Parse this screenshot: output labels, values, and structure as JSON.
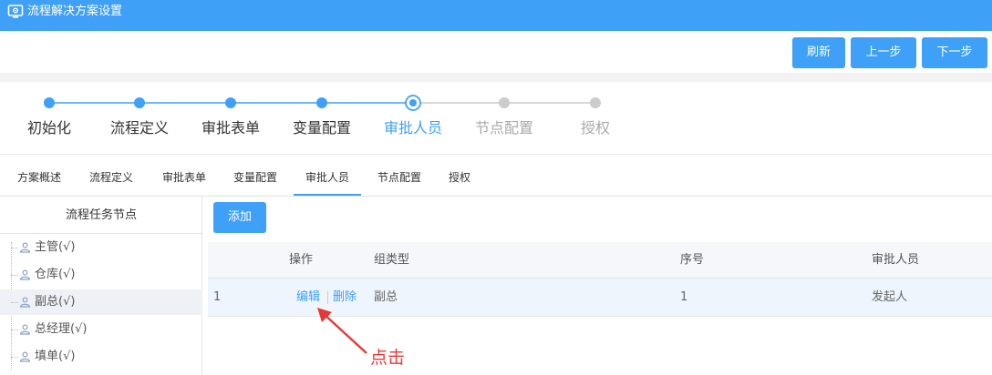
{
  "window": {
    "title": "流程解决方案设置",
    "icon": "settings-monitor-icon"
  },
  "toolbar": {
    "refresh": "刷新",
    "prev": "上一步",
    "next": "下一步"
  },
  "steps": [
    {
      "label": "初始化",
      "state": "done"
    },
    {
      "label": "流程定义",
      "state": "done"
    },
    {
      "label": "审批表单",
      "state": "done"
    },
    {
      "label": "变量配置",
      "state": "done"
    },
    {
      "label": "审批人员",
      "state": "active"
    },
    {
      "label": "节点配置",
      "state": "todo"
    },
    {
      "label": "授权",
      "state": "todo"
    }
  ],
  "tabs": [
    {
      "label": "方案概述"
    },
    {
      "label": "流程定义"
    },
    {
      "label": "审批表单"
    },
    {
      "label": "变量配置"
    },
    {
      "label": "审批人员",
      "active": true
    },
    {
      "label": "节点配置"
    },
    {
      "label": "授权"
    }
  ],
  "tree": {
    "header": "流程任务节点",
    "items": [
      {
        "label": "主管(√)"
      },
      {
        "label": "仓库(√)"
      },
      {
        "label": "副总(√)",
        "selected": true
      },
      {
        "label": "总经理(√)"
      },
      {
        "label": "填单(√)"
      }
    ]
  },
  "table": {
    "add_label": "添加",
    "columns": {
      "operation": "操作",
      "group_type": "组类型",
      "order": "序号",
      "approver": "审批人员"
    },
    "rows": [
      {
        "index": "1",
        "edit": "编辑",
        "delete": "删除",
        "group_type": "副总",
        "order": "1",
        "approver": "发起人"
      }
    ]
  },
  "annotation": {
    "text": "点击",
    "color": "#e53935"
  },
  "colors": {
    "primary": "#3fa0f8",
    "inactive": "#cccccc",
    "highlight_row": "#eef5fd"
  }
}
